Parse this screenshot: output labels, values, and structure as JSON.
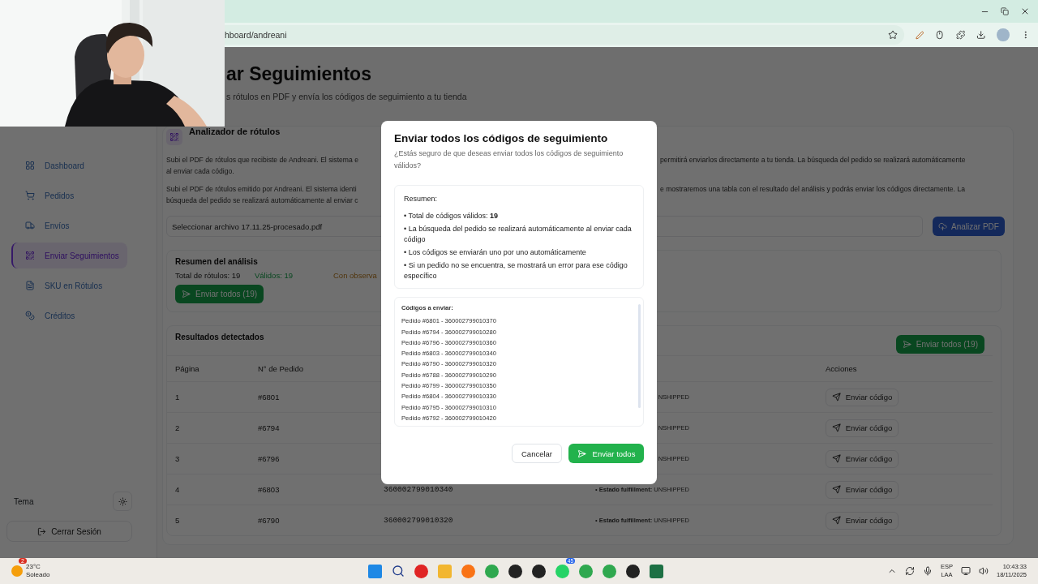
{
  "browser": {
    "url": "hboard/andreani"
  },
  "page_header": {
    "title": "ar Seguimientos",
    "subtitle": "s rótulos en PDF y envía los códigos de seguimiento a tu tienda"
  },
  "sidebar": {
    "items": [
      {
        "label": "Dashboard",
        "selected": false
      },
      {
        "label": "Pedidos",
        "selected": false
      },
      {
        "label": "Envíos",
        "selected": false
      },
      {
        "label": "Enviar Seguimientos",
        "selected": true
      },
      {
        "label": "SKU en Rótulos",
        "selected": false
      },
      {
        "label": "Créditos",
        "selected": false
      }
    ],
    "theme_label": "Tema",
    "logout": "Cerrar Sesión"
  },
  "analyzer": {
    "title": "Analizador de rótulos",
    "paragraphs": [
      {
        "left": [
          "Subi el PDF de rótulos que recibiste de Andreani. El sistema e",
          "al enviar cada código."
        ],
        "right": "permitirá enviarlos directamente a tu tienda. La búsqueda del pedido se realizará automáticamente"
      },
      {
        "left": [
          "Subi el PDF de rótulos emitido por Andreani. El sistema identi",
          "búsqueda del pedido se realizará automáticamente al enviar c"
        ],
        "right": "e mostraremos una tabla con el resultado del análisis y podrás enviar los códigos directamente. La"
      }
    ],
    "file_field": "Seleccionar archivo 17.11.25-procesado.pdf",
    "analyze_button": "Analizar PDF"
  },
  "summary": {
    "title": "Resumen del análisis",
    "stats": [
      {
        "text": "Total de rótulos: 19",
        "kind": "total"
      },
      {
        "text": "Válidos: 19",
        "kind": "valid"
      },
      {
        "text": "Con observa",
        "kind": "warning"
      }
    ],
    "button": "Enviar todos (19)"
  },
  "results": {
    "title": "Resultados detectados",
    "button": "Enviar todos (19)",
    "columns": {
      "page": "Página",
      "order": "N° de Pedido",
      "actions": "Acciones"
    },
    "rows": [
      {
        "page": "1",
        "order": "#6801",
        "status": "NSHIPPED",
        "action": "Enviar código"
      },
      {
        "page": "2",
        "order": "#6794",
        "status": "NSHIPPED",
        "action": "Enviar código"
      },
      {
        "page": "3",
        "order": "#6796",
        "status": "NSHIPPED",
        "action": "Enviar código"
      },
      {
        "page": "4",
        "order": "#6803",
        "code": "360002799010340",
        "status": "• **Estado fulfillment:** UNSHIPPED",
        "action": "Enviar código"
      },
      {
        "page": "5",
        "order": "#6790",
        "code": "360002799010320",
        "status": "• **Estado fulfillment:** UNSHIPPED",
        "action": "Enviar código"
      }
    ]
  },
  "modal": {
    "title": "Enviar todos los códigos de seguimiento",
    "question": "¿Estás seguro de que deseas enviar todos los códigos de seguimiento válidos?",
    "summary_title": "Resumen:",
    "summary_items": [
      "• Total de códigos válidos: **19**",
      "• La búsqueda del pedido se realizará automáticamente al enviar cada código",
      "• Los códigos se enviarán uno por uno automáticamente",
      "• Si un pedido no se encuentra, se mostrará un error para ese código específico"
    ],
    "codes_title": "Códigos a enviar:",
    "codes": [
      "Pedido #6801 - 360002799010370",
      "Pedido #6794 - 360002799010280",
      "Pedido #6796 - 360002799010360",
      "Pedido #6803 - 360002799010340",
      "Pedido #6790 - 360002799010320",
      "Pedido #6788 - 360002799010290",
      "Pedido #6799 - 360002799010350",
      "Pedido #6804 - 360002799010330",
      "Pedido #6795 - 360002799010310",
      "Pedido #6792 - 360002799010420"
    ],
    "cancel": "Cancelar",
    "confirm": "Enviar todos"
  },
  "taskbar": {
    "weather": {
      "temp": "23°C",
      "condition": "Soleado",
      "badge": "2"
    },
    "apps": [
      {
        "kind": "windows"
      },
      {
        "kind": "search"
      },
      {
        "kind": "music"
      },
      {
        "kind": "folder"
      },
      {
        "kind": "firefox"
      },
      {
        "kind": "chrome"
      },
      {
        "kind": "dark"
      },
      {
        "kind": "dark"
      },
      {
        "kind": "whatsapp",
        "badge": "45"
      },
      {
        "kind": "chrome"
      },
      {
        "kind": "chrome"
      },
      {
        "kind": "dark"
      },
      {
        "kind": "excel"
      }
    ],
    "language": "ESP",
    "region": "LAA",
    "time": "10:43:33",
    "date": "18/11/2025"
  }
}
